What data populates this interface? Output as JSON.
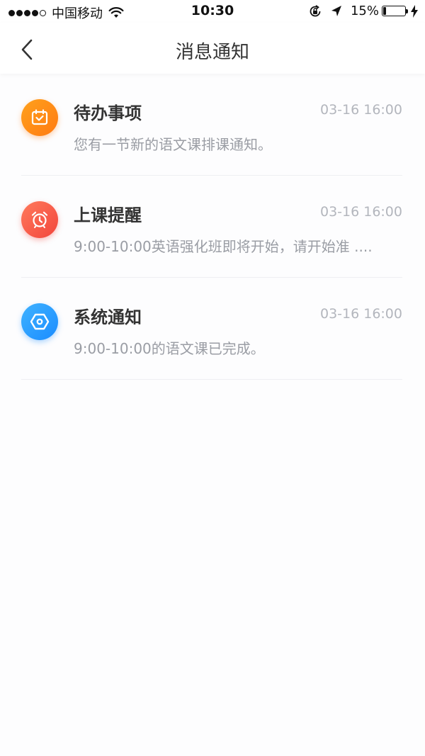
{
  "status_bar": {
    "carrier": "中国移动",
    "time": "10:30",
    "battery_percent": "15%",
    "battery_level": 0.15
  },
  "nav": {
    "title": "消息通知"
  },
  "notifications": [
    {
      "title": "待办事项",
      "time": "03-16 16:00",
      "desc": "您有一节新的语文课排课通知。",
      "icon": "calendar-check-icon",
      "color_from": "#ffa11c",
      "color_to": "#ff7a12"
    },
    {
      "title": "上课提醒",
      "time": "03-16 16:00",
      "desc": "9:00-10:00英语强化班即将开始，请开始准 ....",
      "icon": "alarm-clock-icon",
      "color_from": "#ff7a5c",
      "color_to": "#f2453c"
    },
    {
      "title": "系统通知",
      "time": "03-16 16:00",
      "desc": "9:00-10:00的语文课已完成。",
      "icon": "system-hexagon-icon",
      "color_from": "#3fb2ff",
      "color_to": "#1a8cff"
    }
  ]
}
